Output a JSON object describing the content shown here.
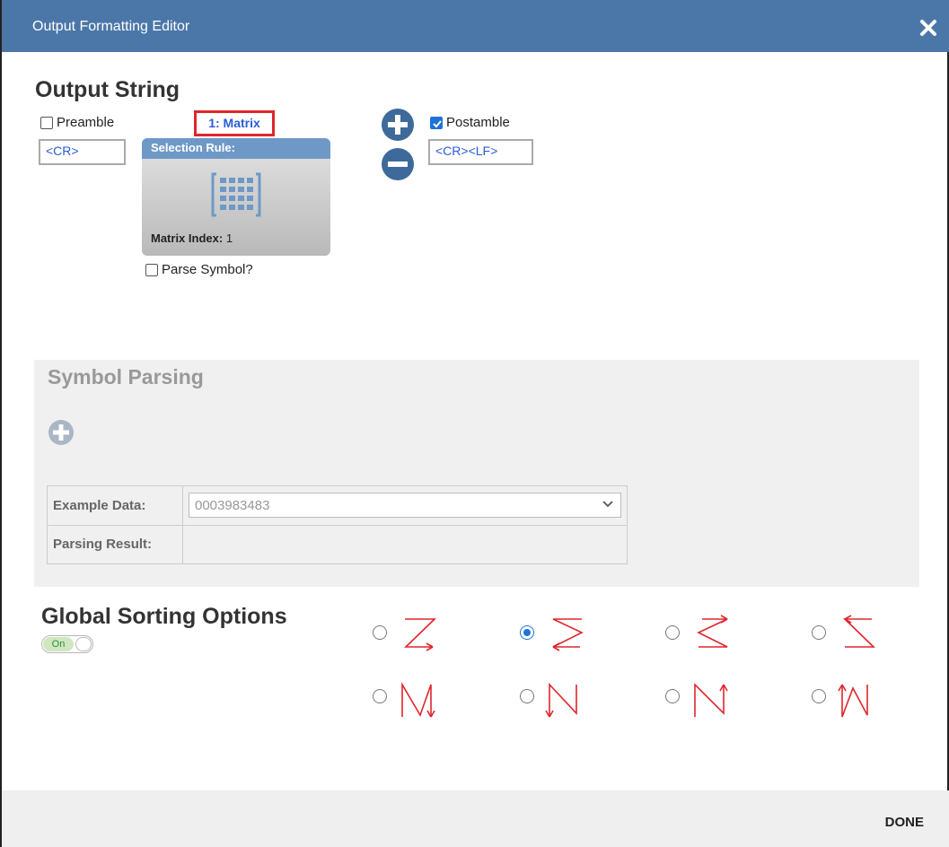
{
  "window": {
    "title": "Output Formatting Editor"
  },
  "output_string": {
    "heading": "Output String",
    "preamble_label": "Preamble",
    "preamble_checked": false,
    "preamble_value": "<CR>",
    "symbol_tag": "1: Matrix",
    "selection_rule_label": "Selection Rule:",
    "matrix_index_label": "Matrix Index:",
    "matrix_index_value": "1",
    "parse_symbol_label": "Parse Symbol?",
    "parse_symbol_checked": false,
    "postamble_label": "Postamble",
    "postamble_checked": true,
    "postamble_value": "<CR><LF>"
  },
  "symbol_parsing": {
    "heading": "Symbol Parsing",
    "example_data_label": "Example Data:",
    "example_data_value": "0003983483",
    "parsing_result_label": "Parsing Result:",
    "parsing_result_value": ""
  },
  "global_sorting": {
    "heading": "Global Sorting Options",
    "toggle_label": "On",
    "selected_index": 1,
    "options": [
      "z-pattern-right-down",
      "s-pattern-left-down",
      "s-pattern-right-up",
      "z-pattern-left-up",
      "n-pattern-down-right",
      "n-pattern-down-column",
      "n-pattern-up-right",
      "n-pattern-up-left"
    ]
  },
  "footer": {
    "done_label": "DONE"
  },
  "colors": {
    "titlebar": "#4b77a8",
    "accent": "#1e73d8",
    "highlight": "#e0252b",
    "pattern_stroke": "#e0252b"
  }
}
